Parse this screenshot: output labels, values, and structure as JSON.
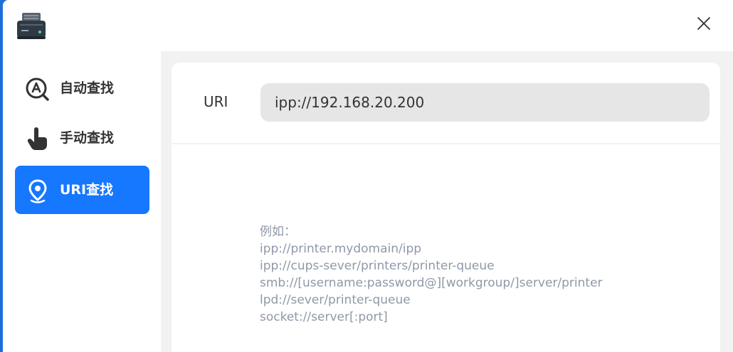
{
  "dialog": {
    "app_icon": "printer-icon",
    "close_icon": "close-icon"
  },
  "sidebar": {
    "items": [
      {
        "label": "自动查找",
        "icon": "auto-search-icon",
        "active": false
      },
      {
        "label": "手动查找",
        "icon": "hand-pointer-icon",
        "active": false
      },
      {
        "label": "URI查找",
        "icon": "location-pin-icon",
        "active": true
      }
    ]
  },
  "main": {
    "uri_label": "URI",
    "uri_value": "ipp://192.168.20.200",
    "examples": [
      "例如：",
      "ipp://printer.mydomain/ipp",
      "ipp://cups-sever/printers/printer-queue",
      "smb://[username:password@][workgroup/]server/printer",
      "lpd://sever/printer-queue",
      "socket://server[:port]"
    ]
  },
  "colors": {
    "accent": "#1677ff",
    "hint_text": "#8f98a8",
    "input_bg": "#e6e6e6"
  }
}
